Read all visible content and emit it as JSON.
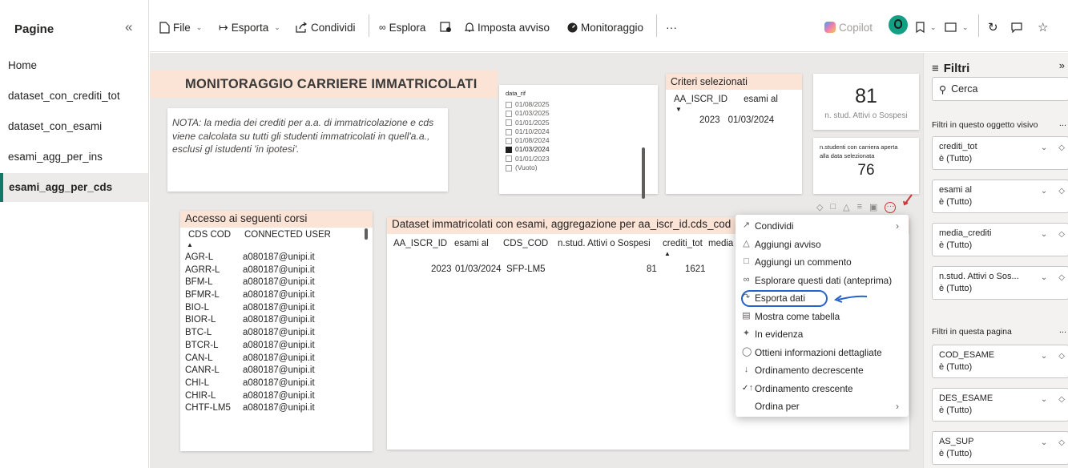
{
  "pages_pane": {
    "title": "Pagine",
    "collapse_icon": "«",
    "items": [
      {
        "label": "Home",
        "active": false
      },
      {
        "label": "dataset_con_crediti_tot",
        "active": false
      },
      {
        "label": "dataset_con_esami",
        "active": false
      },
      {
        "label": "esami_agg_per_ins",
        "active": false
      },
      {
        "label": "esami_agg_per_cds",
        "active": true
      }
    ]
  },
  "toolbar": {
    "file": "File",
    "esporta": "Esporta",
    "condividi": "Condividi",
    "esplora": "Esplora",
    "imposta_avviso": "Imposta avviso",
    "monitoraggio": "Monitoraggio",
    "more": "···",
    "copilot": "Copilot"
  },
  "report": {
    "title": "MONITORAGGIO CARRIERE IMMATRICOLATI",
    "note": "NOTA: la media dei crediti per  a.a. di immatricolazione e cds viene calcolata su tutti gli studenti  immatricolati in quell'a.a., esclusi gl istudenti 'in ipotesi'.",
    "slicer": {
      "title": "data_rif",
      "options": [
        {
          "label": "01/08/2025",
          "checked": false
        },
        {
          "label": "01/03/2025",
          "checked": false
        },
        {
          "label": "01/01/2025",
          "checked": false
        },
        {
          "label": "01/10/2024",
          "checked": false
        },
        {
          "label": "01/08/2024",
          "checked": false
        },
        {
          "label": "01/03/2024",
          "checked": true
        },
        {
          "label": "01/01/2023",
          "checked": false
        },
        {
          "label": "(Vuoto)",
          "checked": false
        }
      ]
    },
    "criteria": {
      "title": "Criteri selezionati",
      "col1": "AA_ISCR_ID",
      "col2": "esami al",
      "val1": "2023",
      "val2": "01/03/2024"
    },
    "kpi1": {
      "value": "81",
      "label": "n. stud. Attivi o Sospesi"
    },
    "kpi2": {
      "label1": "n.studenti con carriera aperta",
      "label2": "alla data selezionata",
      "value": "76"
    },
    "corsi": {
      "title": "Accesso ai seguenti corsi",
      "col1": "CDS COD",
      "col2": "CONNECTED USER",
      "rows": [
        [
          "AGR-L",
          "a080187@unipi.it"
        ],
        [
          "AGRR-L",
          "a080187@unipi.it"
        ],
        [
          "BFM-L",
          "a080187@unipi.it"
        ],
        [
          "BFMR-L",
          "a080187@unipi.it"
        ],
        [
          "BIO-L",
          "a080187@unipi.it"
        ],
        [
          "BIOR-L",
          "a080187@unipi.it"
        ],
        [
          "BTC-L",
          "a080187@unipi.it"
        ],
        [
          "BTCR-L",
          "a080187@unipi.it"
        ],
        [
          "CAN-L",
          "a080187@unipi.it"
        ],
        [
          "CANR-L",
          "a080187@unipi.it"
        ],
        [
          "CHI-L",
          "a080187@unipi.it"
        ],
        [
          "CHIR-L",
          "a080187@unipi.it"
        ],
        [
          "CHTF-LM5",
          "a080187@unipi.it"
        ]
      ]
    },
    "dataset": {
      "title": "Dataset immatricolati con esami, aggregazione per aa_iscr_id.cds_cod",
      "columns": [
        "AA_ISCR_ID",
        "esami al",
        "CDS_COD",
        "n.stud. Attivi o Sospesi",
        "crediti_tot",
        "media"
      ],
      "row": [
        "2023",
        "01/03/2024",
        "SFP-LM5",
        "81",
        "1621"
      ]
    }
  },
  "context_menu": {
    "items": [
      {
        "label": "Condividi",
        "icon": "share-icon",
        "submenu": true
      },
      {
        "label": "Aggiungi avviso",
        "icon": "bell-icon"
      },
      {
        "label": "Aggiungi un commento",
        "icon": "comment-icon"
      },
      {
        "label": "Esplorare questi dati (anteprima)",
        "icon": "binoculars-icon"
      },
      {
        "label": "Esporta dati",
        "icon": "export-icon",
        "highlighted": true
      },
      {
        "label": "Mostra come tabella",
        "icon": "table-icon"
      },
      {
        "label": "In evidenza",
        "icon": "spotlight-icon"
      },
      {
        "label": "Ottieni informazioni dettagliate",
        "icon": "lightbulb-icon"
      },
      {
        "label": "Ordinamento decrescente",
        "icon": "sort-desc-icon"
      },
      {
        "label": "Ordinamento crescente",
        "icon": "sort-asc-icon",
        "checked": true
      },
      {
        "label": "Ordina per",
        "submenu": true
      }
    ]
  },
  "filters_pane": {
    "title": "Filtri",
    "search_placeholder": "Cerca",
    "section_visual": "Filtri in questo oggetto visivo",
    "section_page": "Filtri in questa pagina",
    "visual_filters": [
      {
        "name": "crediti_tot",
        "value": "è (Tutto)"
      },
      {
        "name": "esami al",
        "value": "è (Tutto)"
      },
      {
        "name": "media_crediti",
        "value": "è (Tutto)"
      },
      {
        "name": "n.stud. Attivi o Sos...",
        "value": "è (Tutto)"
      }
    ],
    "page_filters": [
      {
        "name": "COD_ESAME",
        "value": "è (Tutto)"
      },
      {
        "name": "DES_ESAME",
        "value": "è (Tutto)"
      },
      {
        "name": "AS_SUP",
        "value": "è (Tutto)"
      }
    ]
  },
  "colors": {
    "accent": "#117865",
    "header_bg": "#fbe3d6",
    "annotation": "#2563c9"
  }
}
